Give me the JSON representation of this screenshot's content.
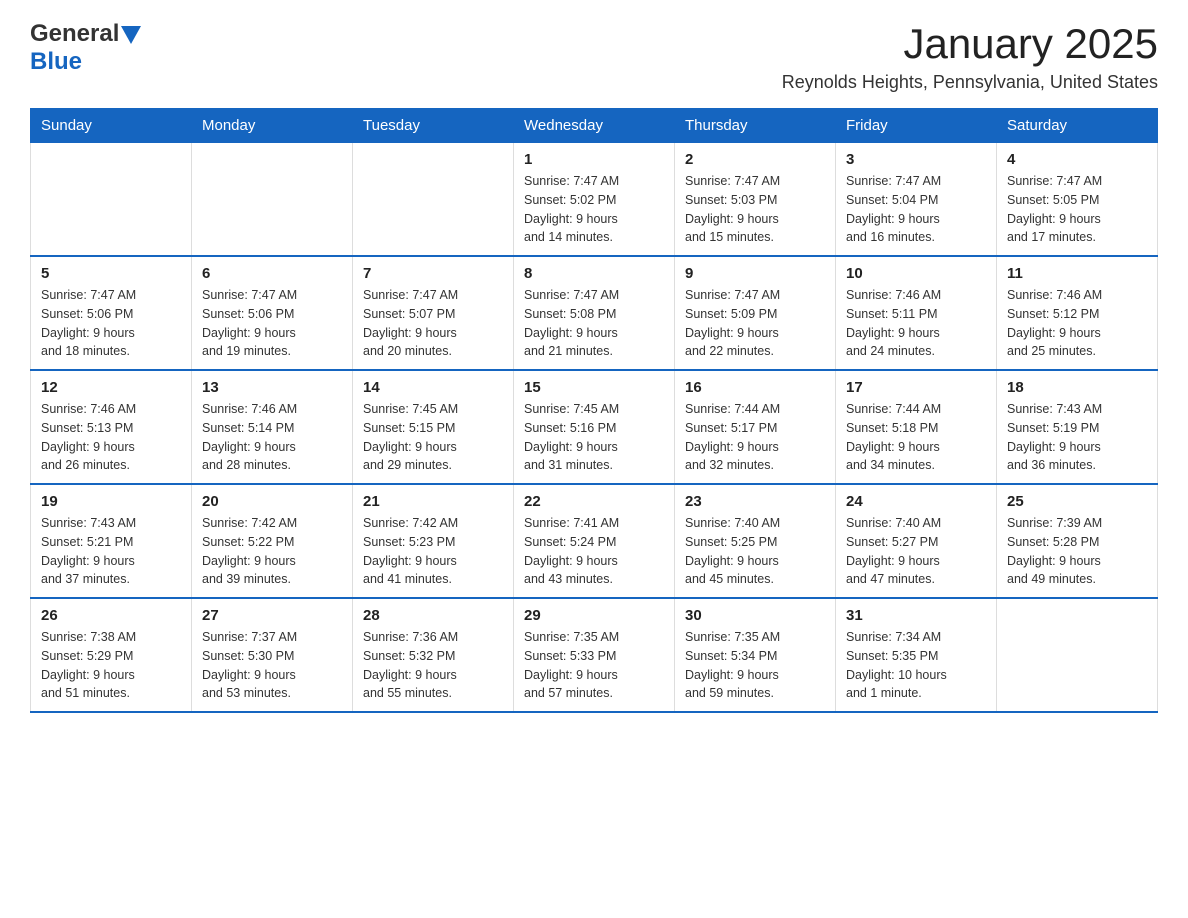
{
  "header": {
    "logo_general": "General",
    "logo_blue": "Blue",
    "month_year": "January 2025",
    "location": "Reynolds Heights, Pennsylvania, United States"
  },
  "weekdays": [
    "Sunday",
    "Monday",
    "Tuesday",
    "Wednesday",
    "Thursday",
    "Friday",
    "Saturday"
  ],
  "weeks": [
    [
      {
        "day": "",
        "info": ""
      },
      {
        "day": "",
        "info": ""
      },
      {
        "day": "",
        "info": ""
      },
      {
        "day": "1",
        "info": "Sunrise: 7:47 AM\nSunset: 5:02 PM\nDaylight: 9 hours\nand 14 minutes."
      },
      {
        "day": "2",
        "info": "Sunrise: 7:47 AM\nSunset: 5:03 PM\nDaylight: 9 hours\nand 15 minutes."
      },
      {
        "day": "3",
        "info": "Sunrise: 7:47 AM\nSunset: 5:04 PM\nDaylight: 9 hours\nand 16 minutes."
      },
      {
        "day": "4",
        "info": "Sunrise: 7:47 AM\nSunset: 5:05 PM\nDaylight: 9 hours\nand 17 minutes."
      }
    ],
    [
      {
        "day": "5",
        "info": "Sunrise: 7:47 AM\nSunset: 5:06 PM\nDaylight: 9 hours\nand 18 minutes."
      },
      {
        "day": "6",
        "info": "Sunrise: 7:47 AM\nSunset: 5:06 PM\nDaylight: 9 hours\nand 19 minutes."
      },
      {
        "day": "7",
        "info": "Sunrise: 7:47 AM\nSunset: 5:07 PM\nDaylight: 9 hours\nand 20 minutes."
      },
      {
        "day": "8",
        "info": "Sunrise: 7:47 AM\nSunset: 5:08 PM\nDaylight: 9 hours\nand 21 minutes."
      },
      {
        "day": "9",
        "info": "Sunrise: 7:47 AM\nSunset: 5:09 PM\nDaylight: 9 hours\nand 22 minutes."
      },
      {
        "day": "10",
        "info": "Sunrise: 7:46 AM\nSunset: 5:11 PM\nDaylight: 9 hours\nand 24 minutes."
      },
      {
        "day": "11",
        "info": "Sunrise: 7:46 AM\nSunset: 5:12 PM\nDaylight: 9 hours\nand 25 minutes."
      }
    ],
    [
      {
        "day": "12",
        "info": "Sunrise: 7:46 AM\nSunset: 5:13 PM\nDaylight: 9 hours\nand 26 minutes."
      },
      {
        "day": "13",
        "info": "Sunrise: 7:46 AM\nSunset: 5:14 PM\nDaylight: 9 hours\nand 28 minutes."
      },
      {
        "day": "14",
        "info": "Sunrise: 7:45 AM\nSunset: 5:15 PM\nDaylight: 9 hours\nand 29 minutes."
      },
      {
        "day": "15",
        "info": "Sunrise: 7:45 AM\nSunset: 5:16 PM\nDaylight: 9 hours\nand 31 minutes."
      },
      {
        "day": "16",
        "info": "Sunrise: 7:44 AM\nSunset: 5:17 PM\nDaylight: 9 hours\nand 32 minutes."
      },
      {
        "day": "17",
        "info": "Sunrise: 7:44 AM\nSunset: 5:18 PM\nDaylight: 9 hours\nand 34 minutes."
      },
      {
        "day": "18",
        "info": "Sunrise: 7:43 AM\nSunset: 5:19 PM\nDaylight: 9 hours\nand 36 minutes."
      }
    ],
    [
      {
        "day": "19",
        "info": "Sunrise: 7:43 AM\nSunset: 5:21 PM\nDaylight: 9 hours\nand 37 minutes."
      },
      {
        "day": "20",
        "info": "Sunrise: 7:42 AM\nSunset: 5:22 PM\nDaylight: 9 hours\nand 39 minutes."
      },
      {
        "day": "21",
        "info": "Sunrise: 7:42 AM\nSunset: 5:23 PM\nDaylight: 9 hours\nand 41 minutes."
      },
      {
        "day": "22",
        "info": "Sunrise: 7:41 AM\nSunset: 5:24 PM\nDaylight: 9 hours\nand 43 minutes."
      },
      {
        "day": "23",
        "info": "Sunrise: 7:40 AM\nSunset: 5:25 PM\nDaylight: 9 hours\nand 45 minutes."
      },
      {
        "day": "24",
        "info": "Sunrise: 7:40 AM\nSunset: 5:27 PM\nDaylight: 9 hours\nand 47 minutes."
      },
      {
        "day": "25",
        "info": "Sunrise: 7:39 AM\nSunset: 5:28 PM\nDaylight: 9 hours\nand 49 minutes."
      }
    ],
    [
      {
        "day": "26",
        "info": "Sunrise: 7:38 AM\nSunset: 5:29 PM\nDaylight: 9 hours\nand 51 minutes."
      },
      {
        "day": "27",
        "info": "Sunrise: 7:37 AM\nSunset: 5:30 PM\nDaylight: 9 hours\nand 53 minutes."
      },
      {
        "day": "28",
        "info": "Sunrise: 7:36 AM\nSunset: 5:32 PM\nDaylight: 9 hours\nand 55 minutes."
      },
      {
        "day": "29",
        "info": "Sunrise: 7:35 AM\nSunset: 5:33 PM\nDaylight: 9 hours\nand 57 minutes."
      },
      {
        "day": "30",
        "info": "Sunrise: 7:35 AM\nSunset: 5:34 PM\nDaylight: 9 hours\nand 59 minutes."
      },
      {
        "day": "31",
        "info": "Sunrise: 7:34 AM\nSunset: 5:35 PM\nDaylight: 10 hours\nand 1 minute."
      },
      {
        "day": "",
        "info": ""
      }
    ]
  ]
}
